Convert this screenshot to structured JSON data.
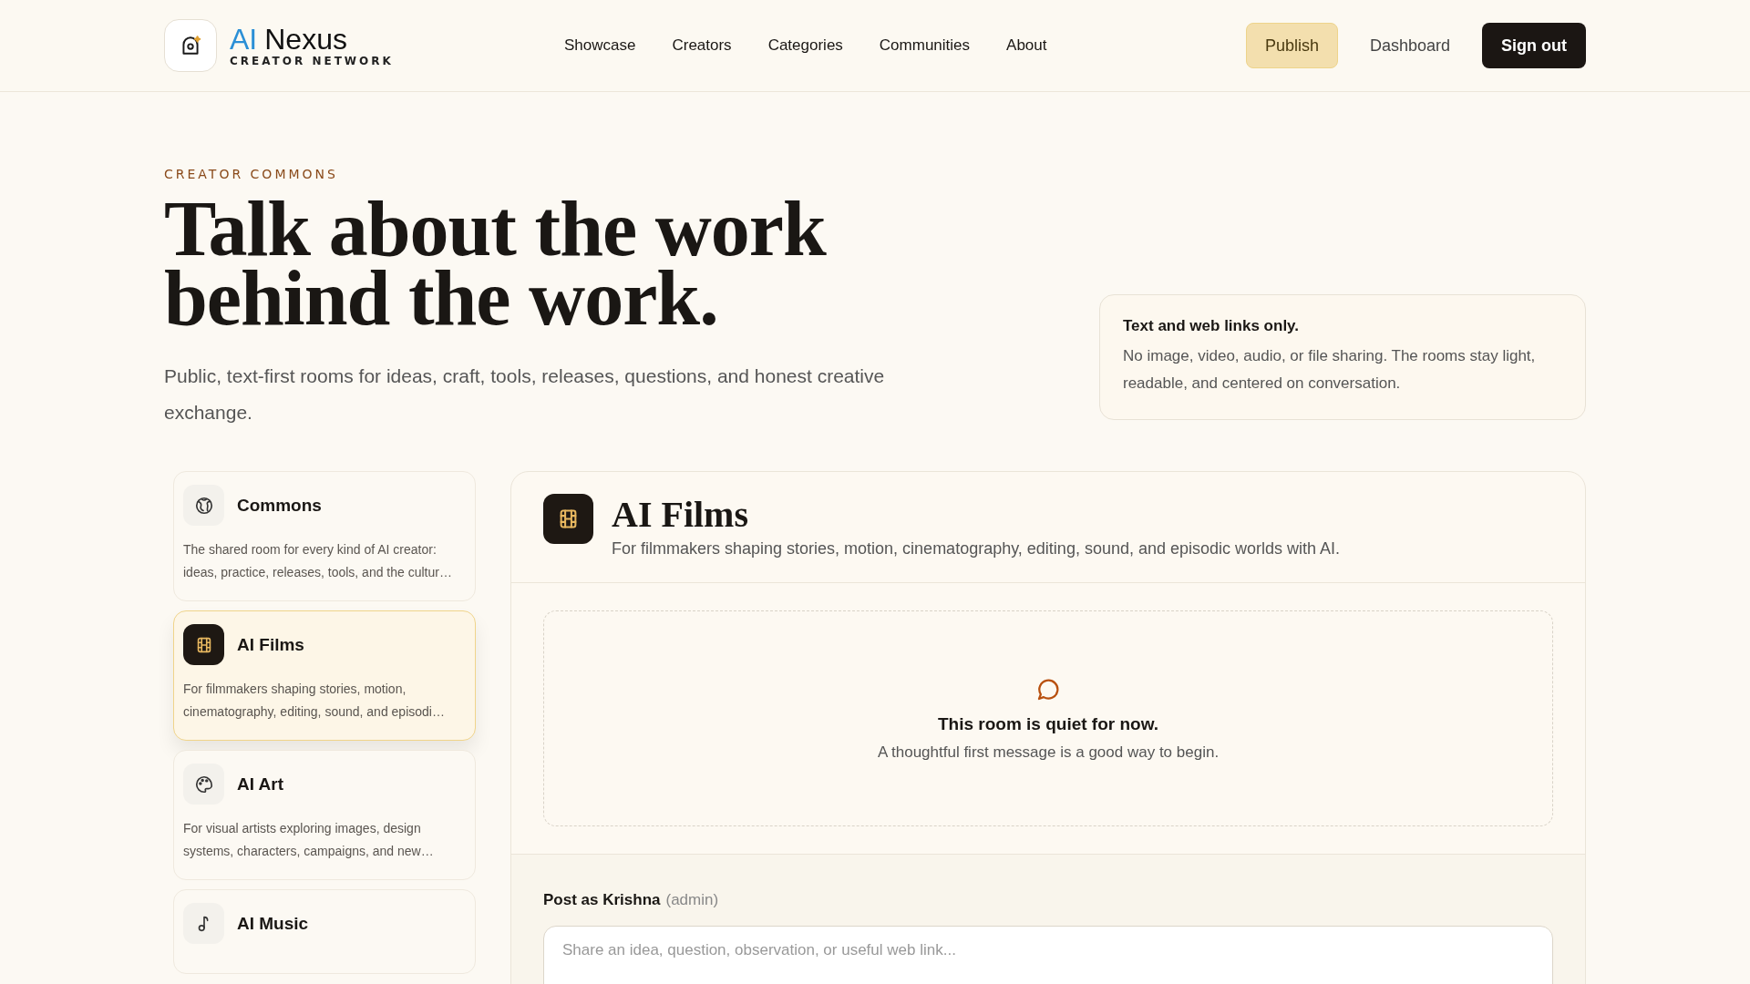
{
  "header": {
    "brand_accent": "AI",
    "brand_name": "Nexus",
    "brand_tagline": "CREATOR NETWORK",
    "nav": [
      {
        "label": "Showcase"
      },
      {
        "label": "Creators"
      },
      {
        "label": "Categories"
      },
      {
        "label": "Communities"
      },
      {
        "label": "About"
      }
    ],
    "actions": [
      {
        "label": "Publish",
        "kind": "highlight"
      },
      {
        "label": "Dashboard",
        "kind": "plain"
      },
      {
        "label": "Sign out",
        "kind": "dark"
      }
    ]
  },
  "hero": {
    "eyebrow": "CREATOR COMMONS",
    "title_lines": [
      "Talk about the work",
      "behind the work."
    ],
    "subtitle": "Public, text-first rooms for ideas, craft, tools, releases, questions, and honest creative exchange."
  },
  "notice": {
    "title": "Text and web links only.",
    "body": "No image, video, audio, or file sharing. The rooms stay light, readable, and centered on conversation."
  },
  "rooms": [
    {
      "kind": "globe",
      "name": "Commons",
      "description": "The shared room for every kind of AI creator: ideas, practice, releases, tools, and the cultur…",
      "selected": false
    },
    {
      "kind": "film",
      "name": "AI Films",
      "description": "For filmmakers shaping stories, motion, cinematography, editing, sound, and episodi…",
      "selected": true
    },
    {
      "kind": "palette",
      "name": "AI Art",
      "description": "For visual artists exploring images, design systems, characters, campaigns, and new…",
      "selected": false
    },
    {
      "kind": "music",
      "name": "AI Music",
      "selected": false
    }
  ],
  "room": {
    "kind": "film",
    "title": "AI Films",
    "description": "For filmmakers shaping stories, motion, cinematography, editing, sound, and episodic worlds with AI.",
    "empty_title": "This room is quiet for now.",
    "empty_body": "A thoughtful first message is a good way to begin.",
    "post_as": "Post as Krishna",
    "post_role": "(admin)",
    "placeholder": "Share an idea, question, observation, or useful web link..."
  }
}
